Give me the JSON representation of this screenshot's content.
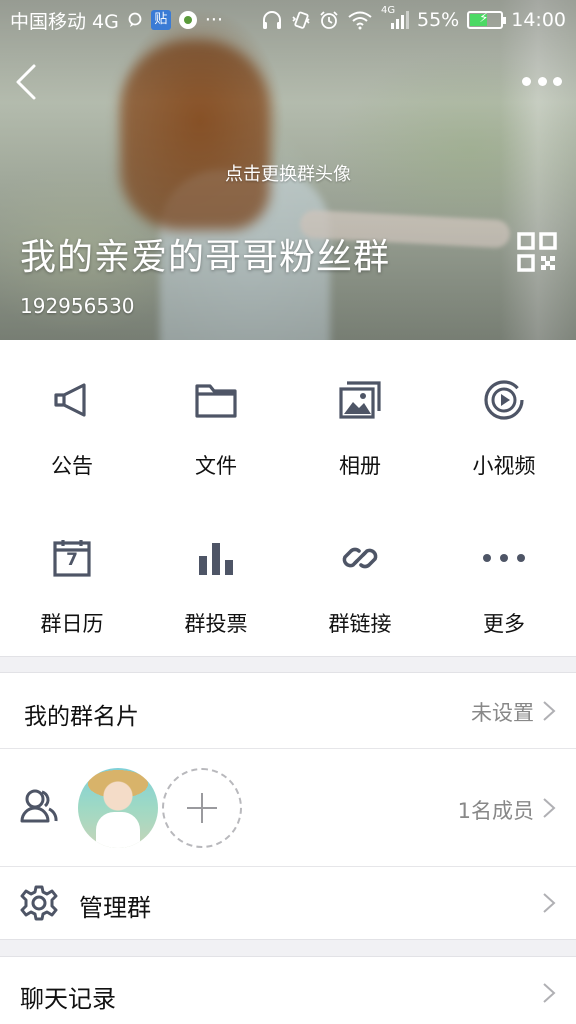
{
  "status_bar": {
    "carrier": "中国移动 4G",
    "badge_text": "贴",
    "dots": "···",
    "network": "4G",
    "battery_percent": "55%",
    "battery_level": 0.55,
    "time": "14:00"
  },
  "header": {
    "change_avatar_hint": "点击更换群头像",
    "group_name": "我的亲爱的哥哥粉丝群",
    "group_id": "192956530",
    "icons": {
      "back": "back-arrow-icon",
      "more": "more-dots-icon",
      "qr": "qr-code-icon"
    }
  },
  "features": [
    {
      "label": "公告",
      "icon": "megaphone-icon"
    },
    {
      "label": "文件",
      "icon": "folder-icon"
    },
    {
      "label": "相册",
      "icon": "photo-album-icon"
    },
    {
      "label": "小视频",
      "icon": "video-play-icon"
    },
    {
      "label": "群日历",
      "icon": "calendar-icon",
      "calendar_day": "7"
    },
    {
      "label": "群投票",
      "icon": "bar-chart-icon"
    },
    {
      "label": "群链接",
      "icon": "link-icon"
    },
    {
      "label": "更多",
      "icon": "more-dots-icon"
    }
  ],
  "my_card": {
    "title": "我的群名片",
    "value": "未设置"
  },
  "members": {
    "count_text": "1名成员",
    "icon": "members-icon"
  },
  "manage": {
    "title": "管理群",
    "icon": "gear-icon"
  },
  "chat_history": {
    "title": "聊天记录"
  },
  "colors": {
    "icon_gray": "#4e5566",
    "divider": "#e6e6e9",
    "section_gap": "#f1f1f4",
    "secondary_text": "#888888"
  }
}
